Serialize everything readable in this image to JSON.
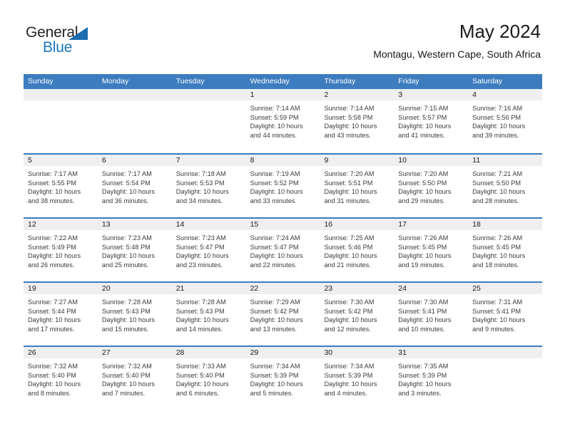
{
  "brand": {
    "word_one": "General",
    "word_two": "Blue",
    "triangle_color": "#1b6cb0",
    "blue_color": "#1b75bb",
    "dark_color": "#231f20"
  },
  "header": {
    "title": "May 2024",
    "subtitle": "Montagu, Western Cape, South Africa"
  },
  "theme": {
    "header_blue": "#3d7cbf",
    "day_band_gray": "#efefef",
    "text_color": "#1a1a1a",
    "body_text_color": "#3b3b3b"
  },
  "calendar": {
    "weekdays": [
      "Sunday",
      "Monday",
      "Tuesday",
      "Wednesday",
      "Thursday",
      "Friday",
      "Saturday"
    ],
    "weeks": [
      [
        {
          "day": "",
          "lines": []
        },
        {
          "day": "",
          "lines": []
        },
        {
          "day": "",
          "lines": []
        },
        {
          "day": "1",
          "lines": [
            "Sunrise: 7:14 AM",
            "Sunset: 5:59 PM",
            "Daylight: 10 hours",
            "and 44 minutes."
          ]
        },
        {
          "day": "2",
          "lines": [
            "Sunrise: 7:14 AM",
            "Sunset: 5:58 PM",
            "Daylight: 10 hours",
            "and 43 minutes."
          ]
        },
        {
          "day": "3",
          "lines": [
            "Sunrise: 7:15 AM",
            "Sunset: 5:57 PM",
            "Daylight: 10 hours",
            "and 41 minutes."
          ]
        },
        {
          "day": "4",
          "lines": [
            "Sunrise: 7:16 AM",
            "Sunset: 5:56 PM",
            "Daylight: 10 hours",
            "and 39 minutes."
          ]
        }
      ],
      [
        {
          "day": "5",
          "lines": [
            "Sunrise: 7:17 AM",
            "Sunset: 5:55 PM",
            "Daylight: 10 hours",
            "and 38 minutes."
          ]
        },
        {
          "day": "6",
          "lines": [
            "Sunrise: 7:17 AM",
            "Sunset: 5:54 PM",
            "Daylight: 10 hours",
            "and 36 minutes."
          ]
        },
        {
          "day": "7",
          "lines": [
            "Sunrise: 7:18 AM",
            "Sunset: 5:53 PM",
            "Daylight: 10 hours",
            "and 34 minutes."
          ]
        },
        {
          "day": "8",
          "lines": [
            "Sunrise: 7:19 AM",
            "Sunset: 5:52 PM",
            "Daylight: 10 hours",
            "and 33 minutes."
          ]
        },
        {
          "day": "9",
          "lines": [
            "Sunrise: 7:20 AM",
            "Sunset: 5:51 PM",
            "Daylight: 10 hours",
            "and 31 minutes."
          ]
        },
        {
          "day": "10",
          "lines": [
            "Sunrise: 7:20 AM",
            "Sunset: 5:50 PM",
            "Daylight: 10 hours",
            "and 29 minutes."
          ]
        },
        {
          "day": "11",
          "lines": [
            "Sunrise: 7:21 AM",
            "Sunset: 5:50 PM",
            "Daylight: 10 hours",
            "and 28 minutes."
          ]
        }
      ],
      [
        {
          "day": "12",
          "lines": [
            "Sunrise: 7:22 AM",
            "Sunset: 5:49 PM",
            "Daylight: 10 hours",
            "and 26 minutes."
          ]
        },
        {
          "day": "13",
          "lines": [
            "Sunrise: 7:23 AM",
            "Sunset: 5:48 PM",
            "Daylight: 10 hours",
            "and 25 minutes."
          ]
        },
        {
          "day": "14",
          "lines": [
            "Sunrise: 7:23 AM",
            "Sunset: 5:47 PM",
            "Daylight: 10 hours",
            "and 23 minutes."
          ]
        },
        {
          "day": "15",
          "lines": [
            "Sunrise: 7:24 AM",
            "Sunset: 5:47 PM",
            "Daylight: 10 hours",
            "and 22 minutes."
          ]
        },
        {
          "day": "16",
          "lines": [
            "Sunrise: 7:25 AM",
            "Sunset: 5:46 PM",
            "Daylight: 10 hours",
            "and 21 minutes."
          ]
        },
        {
          "day": "17",
          "lines": [
            "Sunrise: 7:26 AM",
            "Sunset: 5:45 PM",
            "Daylight: 10 hours",
            "and 19 minutes."
          ]
        },
        {
          "day": "18",
          "lines": [
            "Sunrise: 7:26 AM",
            "Sunset: 5:45 PM",
            "Daylight: 10 hours",
            "and 18 minutes."
          ]
        }
      ],
      [
        {
          "day": "19",
          "lines": [
            "Sunrise: 7:27 AM",
            "Sunset: 5:44 PM",
            "Daylight: 10 hours",
            "and 17 minutes."
          ]
        },
        {
          "day": "20",
          "lines": [
            "Sunrise: 7:28 AM",
            "Sunset: 5:43 PM",
            "Daylight: 10 hours",
            "and 15 minutes."
          ]
        },
        {
          "day": "21",
          "lines": [
            "Sunrise: 7:28 AM",
            "Sunset: 5:43 PM",
            "Daylight: 10 hours",
            "and 14 minutes."
          ]
        },
        {
          "day": "22",
          "lines": [
            "Sunrise: 7:29 AM",
            "Sunset: 5:42 PM",
            "Daylight: 10 hours",
            "and 13 minutes."
          ]
        },
        {
          "day": "23",
          "lines": [
            "Sunrise: 7:30 AM",
            "Sunset: 5:42 PM",
            "Daylight: 10 hours",
            "and 12 minutes."
          ]
        },
        {
          "day": "24",
          "lines": [
            "Sunrise: 7:30 AM",
            "Sunset: 5:41 PM",
            "Daylight: 10 hours",
            "and 10 minutes."
          ]
        },
        {
          "day": "25",
          "lines": [
            "Sunrise: 7:31 AM",
            "Sunset: 5:41 PM",
            "Daylight: 10 hours",
            "and 9 minutes."
          ]
        }
      ],
      [
        {
          "day": "26",
          "lines": [
            "Sunrise: 7:32 AM",
            "Sunset: 5:40 PM",
            "Daylight: 10 hours",
            "and 8 minutes."
          ]
        },
        {
          "day": "27",
          "lines": [
            "Sunrise: 7:32 AM",
            "Sunset: 5:40 PM",
            "Daylight: 10 hours",
            "and 7 minutes."
          ]
        },
        {
          "day": "28",
          "lines": [
            "Sunrise: 7:33 AM",
            "Sunset: 5:40 PM",
            "Daylight: 10 hours",
            "and 6 minutes."
          ]
        },
        {
          "day": "29",
          "lines": [
            "Sunrise: 7:34 AM",
            "Sunset: 5:39 PM",
            "Daylight: 10 hours",
            "and 5 minutes."
          ]
        },
        {
          "day": "30",
          "lines": [
            "Sunrise: 7:34 AM",
            "Sunset: 5:39 PM",
            "Daylight: 10 hours",
            "and 4 minutes."
          ]
        },
        {
          "day": "31",
          "lines": [
            "Sunrise: 7:35 AM",
            "Sunset: 5:39 PM",
            "Daylight: 10 hours",
            "and 3 minutes."
          ]
        },
        {
          "day": "",
          "lines": []
        }
      ]
    ]
  }
}
